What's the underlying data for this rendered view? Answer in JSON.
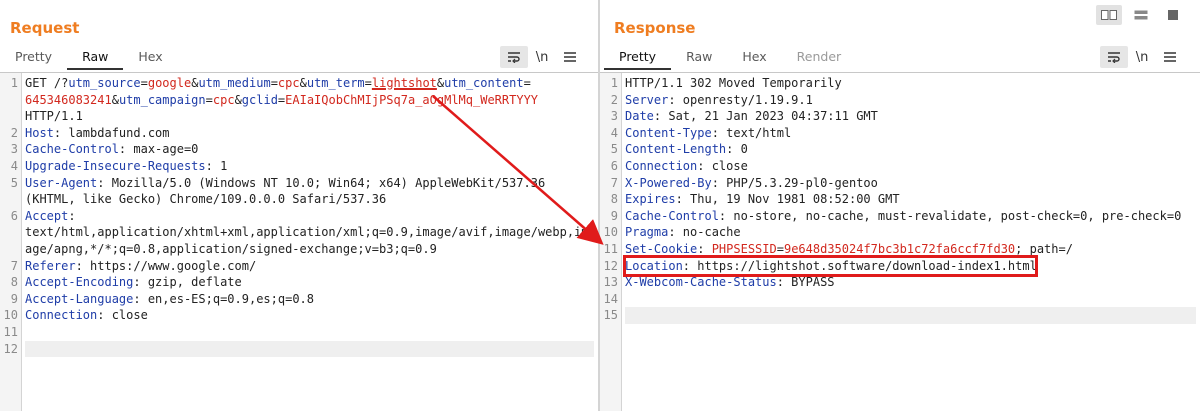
{
  "request": {
    "title": "Request",
    "tabs": [
      "Pretty",
      "Raw",
      "Hex"
    ],
    "active_tab": "Raw",
    "icons": [
      "wrap-icon",
      "newline-icon",
      "menu-icon"
    ],
    "icon_newline_label": "\\n",
    "line_numbers": [
      "1",
      "",
      "",
      "2",
      "3",
      "4",
      "5",
      "",
      "6",
      "",
      "",
      "7",
      "8",
      "9",
      "10",
      "11",
      "12"
    ],
    "lines": [
      {
        "parts": [
          [
            "",
            "GET /?"
          ],
          [
            "p",
            "utm_source"
          ],
          [
            "",
            "="
          ],
          [
            "v",
            "google"
          ],
          [
            "",
            "&"
          ],
          [
            "p",
            "utm_medium"
          ],
          [
            "",
            "="
          ],
          [
            "v",
            "cpc"
          ],
          [
            "",
            "&"
          ],
          [
            "p",
            "utm_term"
          ],
          [
            "",
            "="
          ],
          [
            "v ul",
            "lightshot"
          ],
          [
            "",
            "&"
          ],
          [
            "p",
            "utm_content"
          ],
          [
            "",
            "="
          ]
        ]
      },
      {
        "parts": [
          [
            "v",
            "645346083241"
          ],
          [
            "",
            "&"
          ],
          [
            "p",
            "utm_campaign"
          ],
          [
            "",
            "="
          ],
          [
            "v",
            "cpc"
          ],
          [
            "",
            "&"
          ],
          [
            "p",
            "gclid"
          ],
          [
            "",
            "="
          ],
          [
            "v",
            "EAIaIQobChMIjPSq7a_aOgMlMq_WeRRTYYY"
          ]
        ]
      },
      {
        "parts": [
          [
            "",
            "HTTP/1.1"
          ]
        ]
      },
      {
        "parts": [
          [
            "k",
            "Host"
          ],
          [
            "",
            ": lambdafund.com"
          ]
        ]
      },
      {
        "parts": [
          [
            "k",
            "Cache-Control"
          ],
          [
            "",
            ": max-age=0"
          ]
        ]
      },
      {
        "parts": [
          [
            "k",
            "Upgrade-Insecure-Requests"
          ],
          [
            "",
            ": 1"
          ]
        ]
      },
      {
        "parts": [
          [
            "k",
            "User-Agent"
          ],
          [
            "",
            ": Mozilla/5.0 (Windows NT 10.0; Win64; x64) AppleWebKit/537.36"
          ]
        ]
      },
      {
        "parts": [
          [
            "",
            "(KHTML, like Gecko) Chrome/109.0.0.0 Safari/537.36"
          ]
        ]
      },
      {
        "parts": [
          [
            "k",
            "Accept"
          ],
          [
            "",
            ":"
          ]
        ]
      },
      {
        "parts": [
          [
            "",
            "text/html,application/xhtml+xml,application/xml;q=0.9,image/avif,image/webp,im"
          ]
        ]
      },
      {
        "parts": [
          [
            "",
            "age/apng,*/*;q=0.8,application/signed-exchange;v=b3;q=0.9"
          ]
        ]
      },
      {
        "parts": [
          [
            "k",
            "Referer"
          ],
          [
            "",
            ": https://www.google.com/"
          ]
        ]
      },
      {
        "parts": [
          [
            "k",
            "Accept-Encoding"
          ],
          [
            "",
            ": gzip, deflate"
          ]
        ]
      },
      {
        "parts": [
          [
            "k",
            "Accept-Language"
          ],
          [
            "",
            ": en,es-ES;q=0.9,es;q=0.8"
          ]
        ]
      },
      {
        "parts": [
          [
            "k",
            "Connection"
          ],
          [
            "",
            ": close"
          ]
        ]
      },
      {
        "parts": []
      },
      {
        "parts": []
      }
    ]
  },
  "response": {
    "title": "Response",
    "tabs": [
      "Pretty",
      "Raw",
      "Hex",
      "Render"
    ],
    "active_tab": "Pretty",
    "icons": [
      "wrap-icon",
      "newline-icon",
      "menu-icon"
    ],
    "icon_newline_label": "\\n",
    "view_buttons": [
      "split-vertical-icon",
      "split-horizontal-icon",
      "single-pane-icon"
    ],
    "line_numbers": [
      "1",
      "2",
      "3",
      "4",
      "5",
      "6",
      "7",
      "8",
      "9",
      "10",
      "11",
      "12",
      "13",
      "14",
      "15"
    ],
    "lines": [
      {
        "parts": [
          [
            "",
            "HTTP/1.1 302 Moved Temporarily"
          ]
        ]
      },
      {
        "parts": [
          [
            "k",
            "Server"
          ],
          [
            "",
            ": openresty/1.19.9.1"
          ]
        ]
      },
      {
        "parts": [
          [
            "k",
            "Date"
          ],
          [
            "",
            ": Sat, 21 Jan 2023 04:37:11 GMT"
          ]
        ]
      },
      {
        "parts": [
          [
            "k",
            "Content-Type"
          ],
          [
            "",
            ": text/html"
          ]
        ]
      },
      {
        "parts": [
          [
            "k",
            "Content-Length"
          ],
          [
            "",
            ": 0"
          ]
        ]
      },
      {
        "parts": [
          [
            "k",
            "Connection"
          ],
          [
            "",
            ": close"
          ]
        ]
      },
      {
        "parts": [
          [
            "k",
            "X-Powered-By"
          ],
          [
            "",
            ": PHP/5.3.29-pl0-gentoo"
          ]
        ]
      },
      {
        "parts": [
          [
            "k",
            "Expires"
          ],
          [
            "",
            ": Thu, 19 Nov 1981 08:52:00 GMT"
          ]
        ]
      },
      {
        "parts": [
          [
            "k",
            "Cache-Control"
          ],
          [
            "",
            ": no-store, no-cache, must-revalidate, post-check=0, pre-check=0"
          ]
        ]
      },
      {
        "parts": [
          [
            "k",
            "Pragma"
          ],
          [
            "",
            ": no-cache"
          ]
        ]
      },
      {
        "parts": [
          [
            "k",
            "Set-Cookie"
          ],
          [
            "",
            ": "
          ],
          [
            "ck",
            "PHPSESSID"
          ],
          [
            "",
            "="
          ],
          [
            "ck",
            "9e648d35024f7bc3b1c72fa6ccf7fd30"
          ],
          [
            "",
            "; path=/"
          ]
        ]
      },
      {
        "parts": [
          [
            "k",
            "Location"
          ],
          [
            "",
            ": https://lightshot.software/download-index1.html"
          ]
        ]
      },
      {
        "parts": [
          [
            "k",
            "X-Webcom-Cache-Status"
          ],
          [
            "",
            ": BYPASS"
          ]
        ]
      },
      {
        "parts": []
      },
      {
        "parts": []
      }
    ]
  },
  "annotation": {
    "color": "#e01b1b"
  }
}
